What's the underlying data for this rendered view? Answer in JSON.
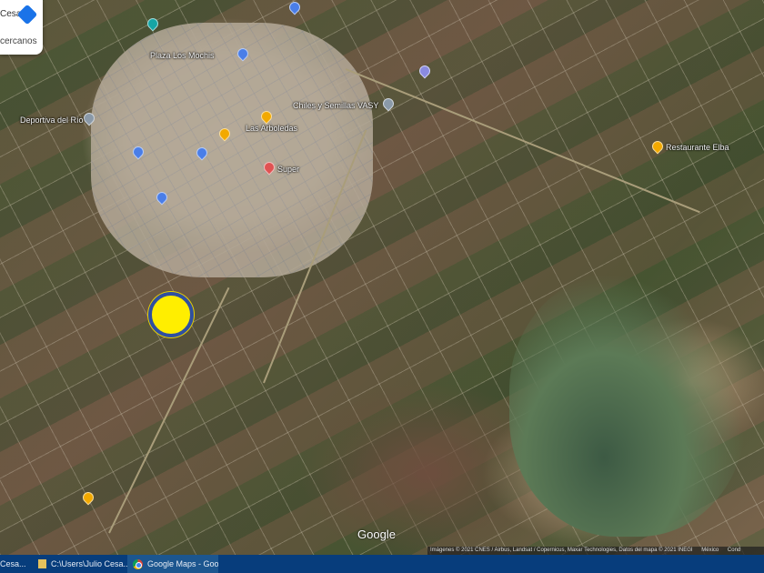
{
  "search": {
    "partial_label": "Cesa",
    "nearby_label": "cercanos"
  },
  "map": {
    "places": [
      {
        "name": "Restaurante Elba",
        "color": "#f2a900"
      },
      {
        "name": "Chiles y Semillas VASY",
        "color": "#8a99a8"
      },
      {
        "name": "Deportiva del Río",
        "color": "#8a99a8"
      },
      {
        "name": "Las Arboledas",
        "color": "#f2a900"
      },
      {
        "name": "Plaza Los Mochis",
        "color": "#4a7ee8"
      },
      {
        "name": "Super",
        "color": "#e05252"
      }
    ],
    "google_logo": "Google",
    "attribution": "Imágenes © 2021 CNES / Airbus, Landsat / Copernicus, Maxar Technologies, Datos del mapa © 2021 INEGI",
    "country": "México",
    "terms": "Cond"
  },
  "taskbar": {
    "items": [
      {
        "label": "Cesa..."
      },
      {
        "label": "C:\\Users\\Julio Cesa..."
      },
      {
        "label": "Google Maps - Goo..."
      }
    ]
  },
  "colors": {
    "marker": "#ffee00",
    "marker_border": "#2f4fa0",
    "taskbar": "#073d7c"
  }
}
